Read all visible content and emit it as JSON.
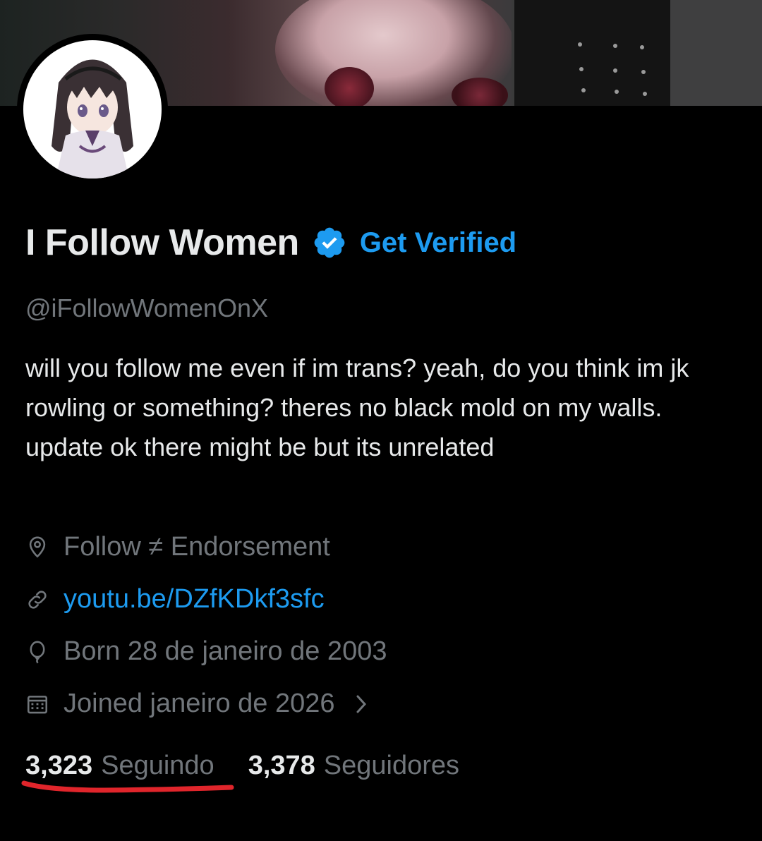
{
  "profile": {
    "display_name": "I Follow Women",
    "get_verified_label": "Get Verified",
    "handle": "@iFollowWomenOnX",
    "bio": "will you follow me even if im trans? yeah, do you think im jk rowling or something? theres no black mold on my walls. update ok there might be but its unrelated",
    "location": "Follow ≠ Endorsement",
    "website": "youtu.be/DZfKDkf3sfc",
    "born": "Born 28 de janeiro de 2003",
    "joined": "Joined janeiro de 2026"
  },
  "stats": {
    "following_count": "3,323",
    "following_label": "Seguindo",
    "followers_count": "3,378",
    "followers_label": "Seguidores"
  },
  "icons": {
    "verified": "verified-badge-icon",
    "location": "location-pin-icon",
    "link": "link-icon",
    "born": "balloon-icon",
    "joined": "calendar-icon",
    "chevron": "chevron-right-icon"
  },
  "colors": {
    "accent": "#1d9bf0",
    "text_primary": "#e7e9ea",
    "text_secondary": "#71767b",
    "annotation": "#e0252b"
  }
}
